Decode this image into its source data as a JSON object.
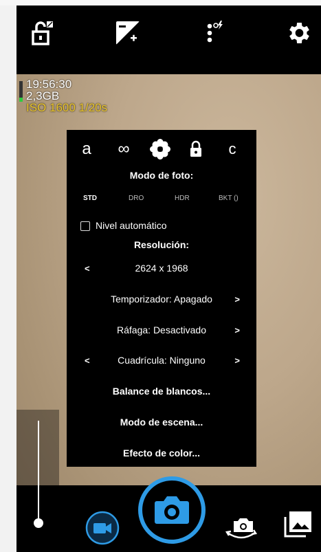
{
  "osd": {
    "time": "19:56:30",
    "free_memory": "2,3GB",
    "exposure": "ISO 1600  1/20s",
    "battery_level": 0.2
  },
  "colors": {
    "accent": "#2e9be6",
    "iso_text": "#e8c32a",
    "battery": "#2ecc40"
  },
  "toolbar": {
    "icons": [
      "exposure-lock-icon",
      "exposure-compensation-icon",
      "flash-mode-icon",
      "settings-icon"
    ]
  },
  "popup": {
    "tabs": [
      {
        "label": "a",
        "icon": "auto-focus-tab"
      },
      {
        "label": "∞",
        "icon": "infinity-focus-icon"
      },
      {
        "label": "",
        "icon": "macro-flower-icon"
      },
      {
        "label": "",
        "icon": "focus-lock-icon"
      },
      {
        "label": "c",
        "icon": "continuous-focus-tab"
      }
    ],
    "photo_mode_title": "Modo de foto:",
    "photo_modes": [
      "STD",
      "DRO",
      "HDR",
      "BKT ()"
    ],
    "photo_mode_selected": "STD",
    "auto_level_label": "Nivel automático",
    "auto_level_checked": false,
    "resolution_title": "Resolución:",
    "resolution_prev": "<",
    "resolution_value": "2624 x 1968",
    "timer_label": "Temporizador: Apagado",
    "timer_next": ">",
    "burst_label": "Ráfaga: Desactivado",
    "burst_next": ">",
    "grid_prev": "<",
    "grid_label": "Cuadrícula: Ninguno",
    "grid_next": ">",
    "white_balance_label": "Balance de blancos...",
    "scene_mode_label": "Modo de escena...",
    "color_effect_label": "Efecto de color..."
  },
  "bottom": {
    "icons": [
      "video-camera-icon",
      "shutter-camera-icon",
      "switch-camera-icon",
      "gallery-icon"
    ]
  }
}
